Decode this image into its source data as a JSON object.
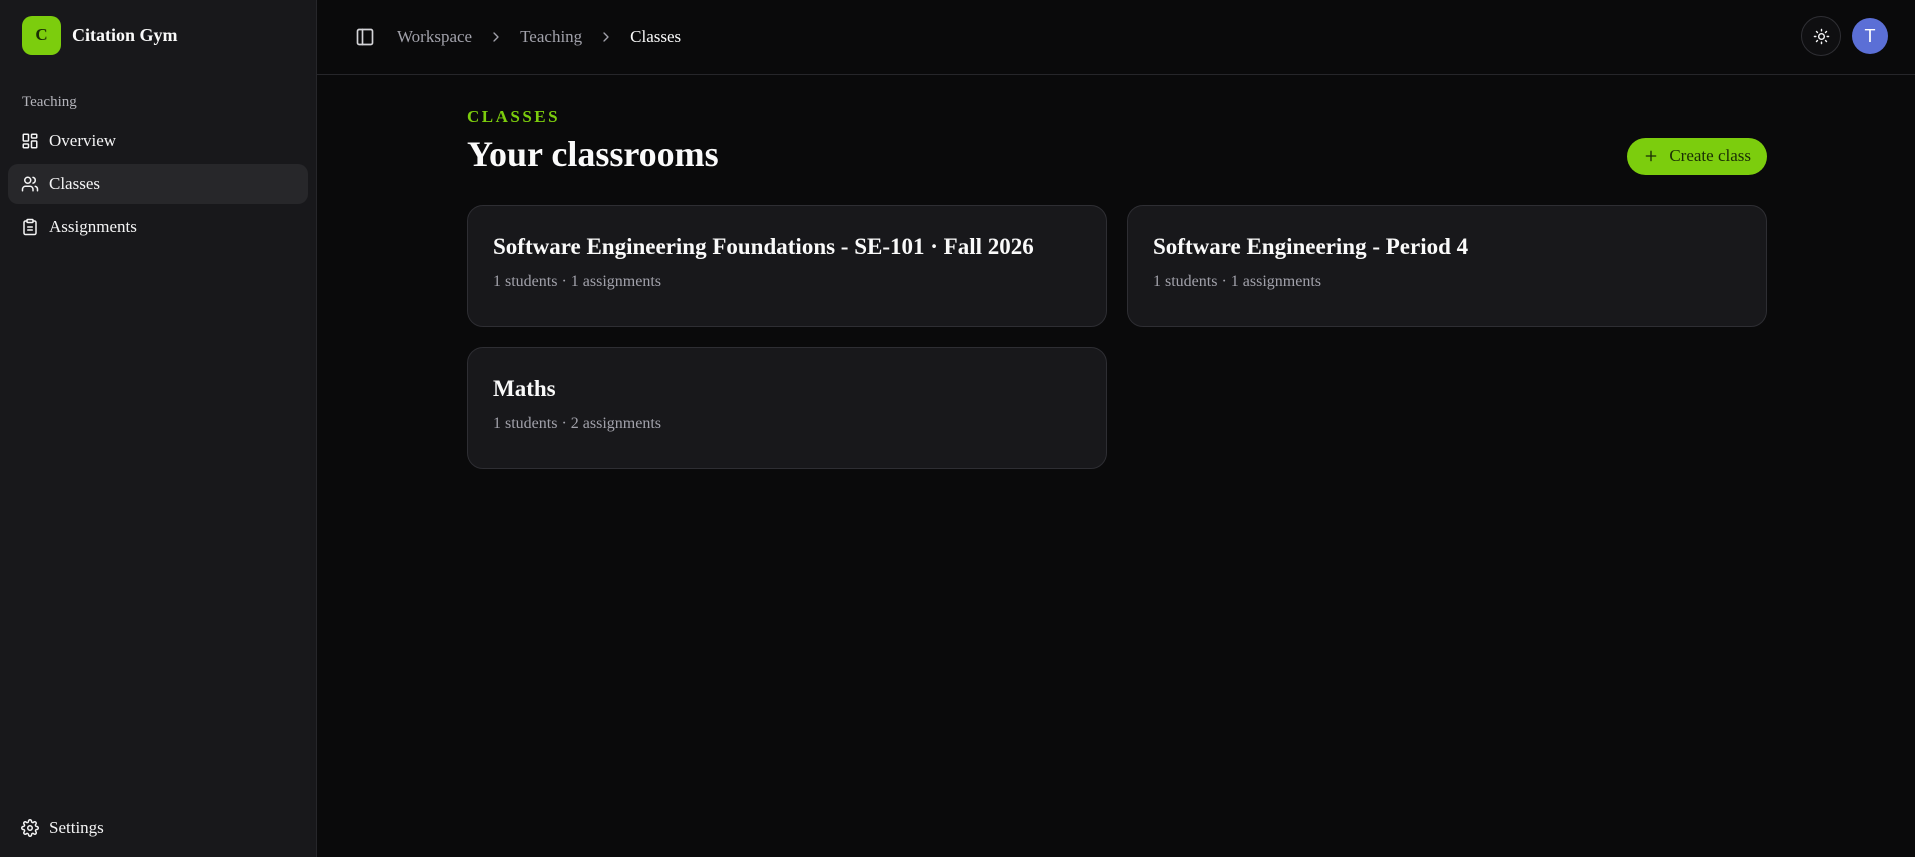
{
  "brand": {
    "initial": "C",
    "name": "Citation Gym"
  },
  "sidebar": {
    "section_label": "Teaching",
    "items": [
      {
        "label": "Overview",
        "icon": "layout-grid-icon"
      },
      {
        "label": "Classes",
        "icon": "users-icon",
        "active": true
      },
      {
        "label": "Assignments",
        "icon": "clipboard-icon"
      }
    ],
    "settings": {
      "label": "Settings",
      "icon": "gear-icon"
    }
  },
  "breadcrumb": [
    "Workspace",
    "Teaching",
    "Classes"
  ],
  "user": {
    "initial": "T",
    "avatar_color": "#5b6fd6"
  },
  "page": {
    "eyebrow": "CLASSES",
    "title": "Your classrooms",
    "create_label": "Create class"
  },
  "classes": [
    {
      "name": "Software Engineering Foundations - SE-101 · Fall 2026",
      "meta": "1 students · 1 assignments"
    },
    {
      "name": "Software Engineering - Period 4",
      "meta": "1 students · 1 assignments"
    },
    {
      "name": "Maths",
      "meta": "1 students · 2 assignments"
    }
  ],
  "colors": {
    "accent": "#7ccd0d",
    "background": "#0a0a0b",
    "sidebar": "#18181b",
    "card": "#18181b"
  }
}
